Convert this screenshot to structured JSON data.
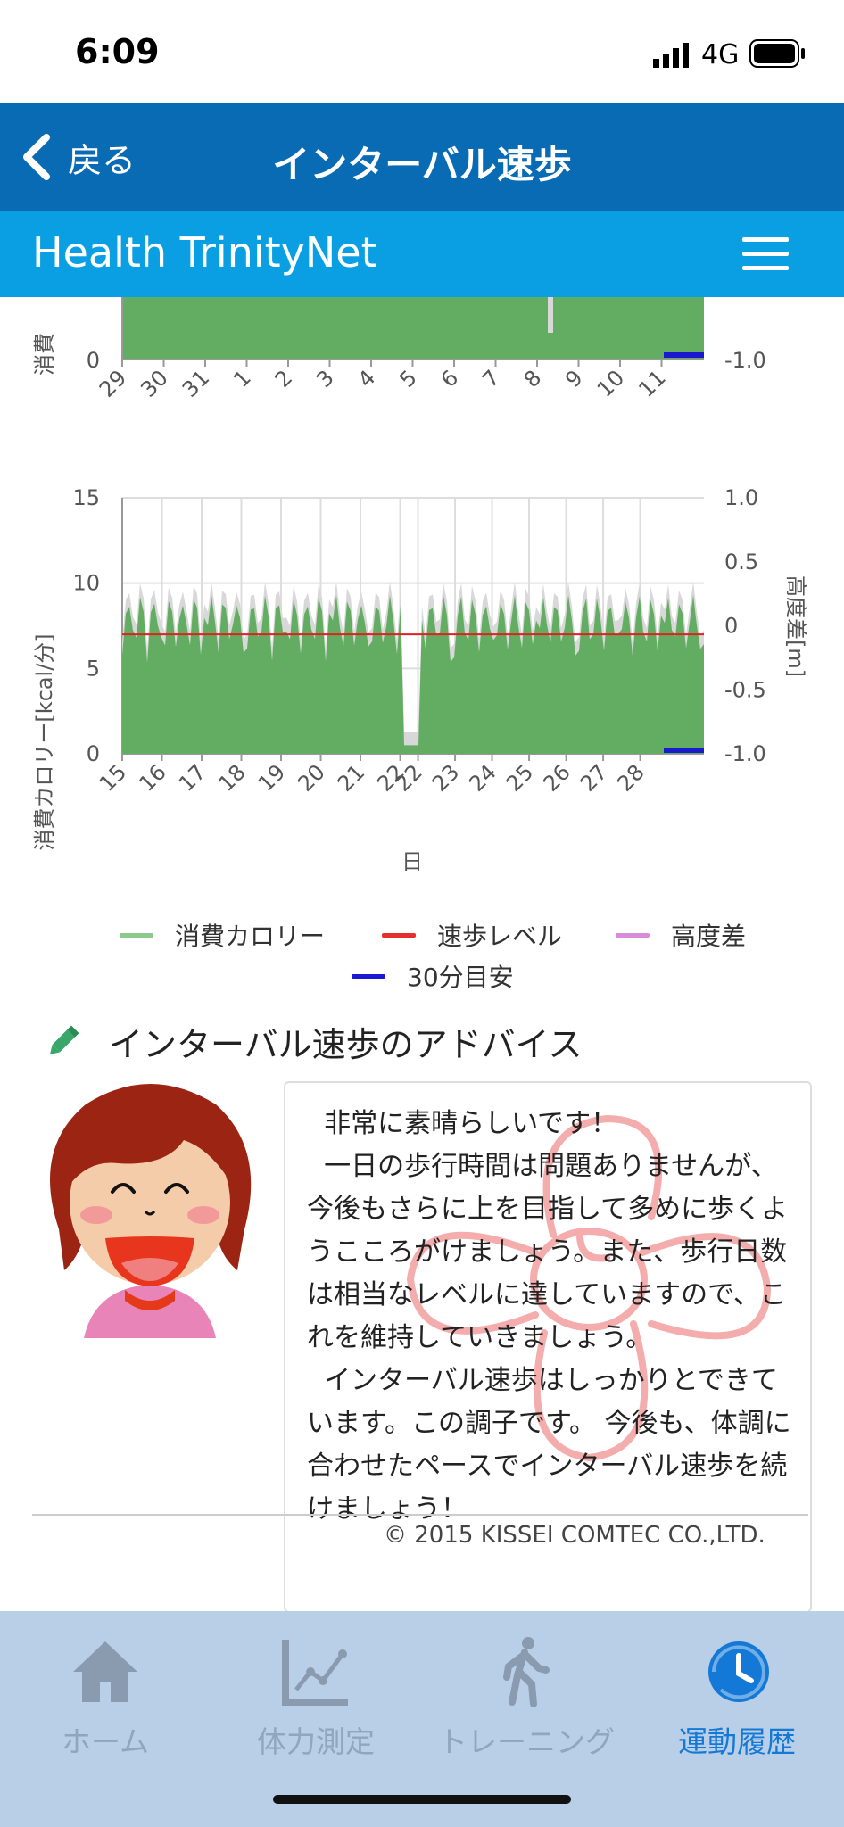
{
  "status_bar": {
    "time": "6:09",
    "network": "4G"
  },
  "nav": {
    "back_label": "戻る",
    "title": "インターバル速歩"
  },
  "brand": {
    "name": "Health TrinityNet"
  },
  "top_chart": {
    "ylabel": "消費",
    "y_left_tick": "0",
    "y_right_tick": "-1.0",
    "x_ticks": [
      "29",
      "30",
      "31",
      "1",
      "2",
      "3",
      "4",
      "5",
      "6",
      "7",
      "8",
      "9",
      "10",
      "11"
    ]
  },
  "chart_data": {
    "type": "area",
    "x_ticks": [
      "15",
      "16",
      "17",
      "18",
      "19",
      "20",
      "21",
      "22",
      "22",
      "23",
      "24",
      "25",
      "26",
      "27",
      "28"
    ],
    "xlabel": "日",
    "ylabel": "消費カロリー[kcal/分]",
    "ylabel_right": "高度差[m]",
    "ylim": [
      0,
      15
    ],
    "y2lim": [
      -1.0,
      1.0
    ],
    "y_ticks": [
      "0",
      "5",
      "10",
      "15"
    ],
    "y2_ticks": [
      "-1.0",
      "-0.5",
      "0",
      "0.5",
      "1.0"
    ],
    "series": [
      {
        "name": "消費カロリー",
        "color": "#5aaa5a",
        "baseline": 5.5,
        "peak": 9.0
      },
      {
        "name": "速歩レベル",
        "color": "#e02020",
        "values": [
          7,
          7
        ]
      },
      {
        "name": "高度差",
        "color": "#d070d0"
      },
      {
        "name": "30分目安",
        "color": "#1a1acc"
      }
    ],
    "grid": true,
    "legend_position": "bottom"
  },
  "legend": [
    {
      "label": "消費カロリー",
      "color": "#8cc98c"
    },
    {
      "label": "速歩レベル",
      "color": "#e62e2e"
    },
    {
      "label": "高度差",
      "color": "#d98cd9"
    },
    {
      "label": "30分目安",
      "color": "#1a1ad6"
    }
  ],
  "advice": {
    "heading": "インターバル速歩のアドバイス",
    "text": "  非常に素晴らしいです！\n  一日の歩行時間は問題ありませんが、今後もさらに上を目指して多めに歩くようこころがけましょう。また、歩行日数は相当なレベルに達していますので、これを維持していきましょう。\n  インターバル速歩はしっかりとできています。この調子です。 今後も、体調に合わせたペースでインターバル速歩を続けましょう！"
  },
  "copyright": "© 2015 KISSEI COMTEC CO.,LTD.",
  "tabs": [
    {
      "label": "ホーム",
      "icon": "home-icon",
      "active": false
    },
    {
      "label": "体力測定",
      "icon": "chart-icon",
      "active": false
    },
    {
      "label": "トレーニング",
      "icon": "walking-icon",
      "active": false
    },
    {
      "label": "運動履歴",
      "icon": "history-icon",
      "active": true
    }
  ]
}
